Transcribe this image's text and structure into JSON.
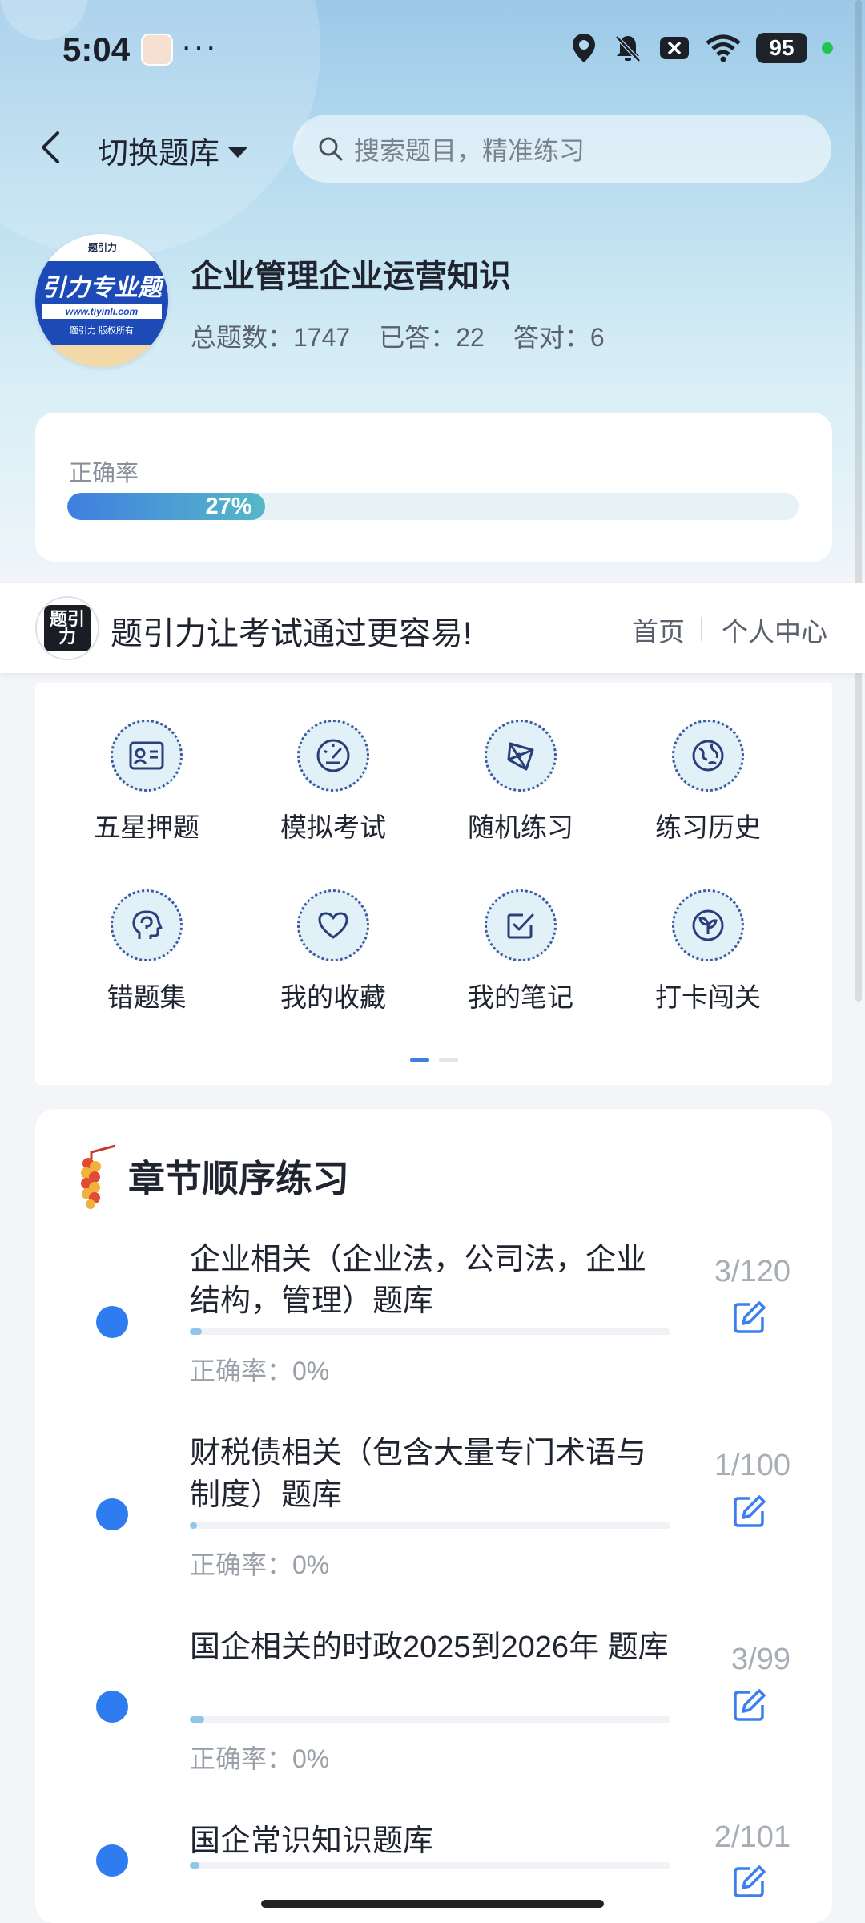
{
  "status_bar": {
    "time": "5:04",
    "dots": "···",
    "battery": "95"
  },
  "header": {
    "switch_label": "切换题库",
    "search_placeholder": "搜索题目，精准练习"
  },
  "bank": {
    "logo": {
      "brand": "引力专业题",
      "site": "www.tiyinli.com",
      "tagline": "题引力 版权所有",
      "mark": "题引力"
    },
    "title": "企业管理企业运营知识",
    "total_label": "总题数：1747",
    "answered_label": "已答：22",
    "correct_label": "答对：6"
  },
  "accuracy": {
    "label": "正确率",
    "percent_text": "27%",
    "fraction": 0.27
  },
  "slogan_bar": {
    "logo_text": "题引力",
    "text": "题引力让考试通过更容易!",
    "nav_home": "首页",
    "nav_personal": "个人中心"
  },
  "features": [
    {
      "label": "五星押题",
      "icon": "id-card-icon"
    },
    {
      "label": "模拟考试",
      "icon": "speedometer-icon"
    },
    {
      "label": "随机练习",
      "icon": "network-icon"
    },
    {
      "label": "练习历史",
      "icon": "globe-icon"
    },
    {
      "label": "错题集",
      "icon": "head-icon"
    },
    {
      "label": "我的收藏",
      "icon": "heart-icon"
    },
    {
      "label": "我的笔记",
      "icon": "checkbox-icon"
    },
    {
      "label": "打卡闯关",
      "icon": "sprout-icon"
    }
  ],
  "chapters": {
    "title": "章节顺序练习",
    "items": [
      {
        "name": "企业相关（企业法，公司法，企业结构，管理）题库",
        "accuracy": "正确率：0%",
        "count": "3/120",
        "progress": 0.025
      },
      {
        "name": "财税债相关（包含大量专门术语与制度）题库",
        "accuracy": "正确率：0%",
        "count": "1/100",
        "progress": 0.01
      },
      {
        "name": "国企相关的时政2025到2026年 题库",
        "accuracy": "正确率：0%",
        "count": "3/99",
        "progress": 0.03
      },
      {
        "name": "国企常识知识题库",
        "accuracy": "",
        "count": "2/101",
        "progress": 0.02
      }
    ]
  },
  "colors": {
    "accent": "#2f7cf0",
    "progress_start": "#3f7fe0",
    "progress_end": "#56b8c8",
    "icon_bg": "#e2f1f7"
  }
}
